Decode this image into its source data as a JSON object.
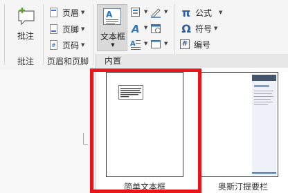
{
  "ribbon": {
    "comment": {
      "button_label": "批注",
      "group_label": "批注"
    },
    "header_footer": {
      "group_label": "页眉和页脚",
      "items": [
        {
          "label": "页眉",
          "icon": "header-icon"
        },
        {
          "label": "页脚",
          "icon": "footer-icon"
        },
        {
          "label": "页码",
          "icon": "page-number-icon"
        }
      ]
    },
    "text": {
      "textbox_label": "文本框"
    },
    "symbols": {
      "items": [
        {
          "glyph": "π",
          "label": "公式",
          "icon": "equation-icon"
        },
        {
          "glyph": "Ω",
          "label": "符号",
          "icon": "symbol-icon"
        },
        {
          "glyph": "#",
          "label": "编号",
          "icon": "number-icon"
        }
      ]
    }
  },
  "gallery": {
    "section_label": "内置",
    "items": [
      {
        "label": "简单文本框",
        "selected": true
      },
      {
        "label": "奥斯汀提要栏",
        "selected": false
      }
    ]
  },
  "colors": {
    "accent": "#2e75b6",
    "highlight": "#e8161b",
    "sidebar_band": "#44546a",
    "sidebar_line": "#4472c4"
  }
}
